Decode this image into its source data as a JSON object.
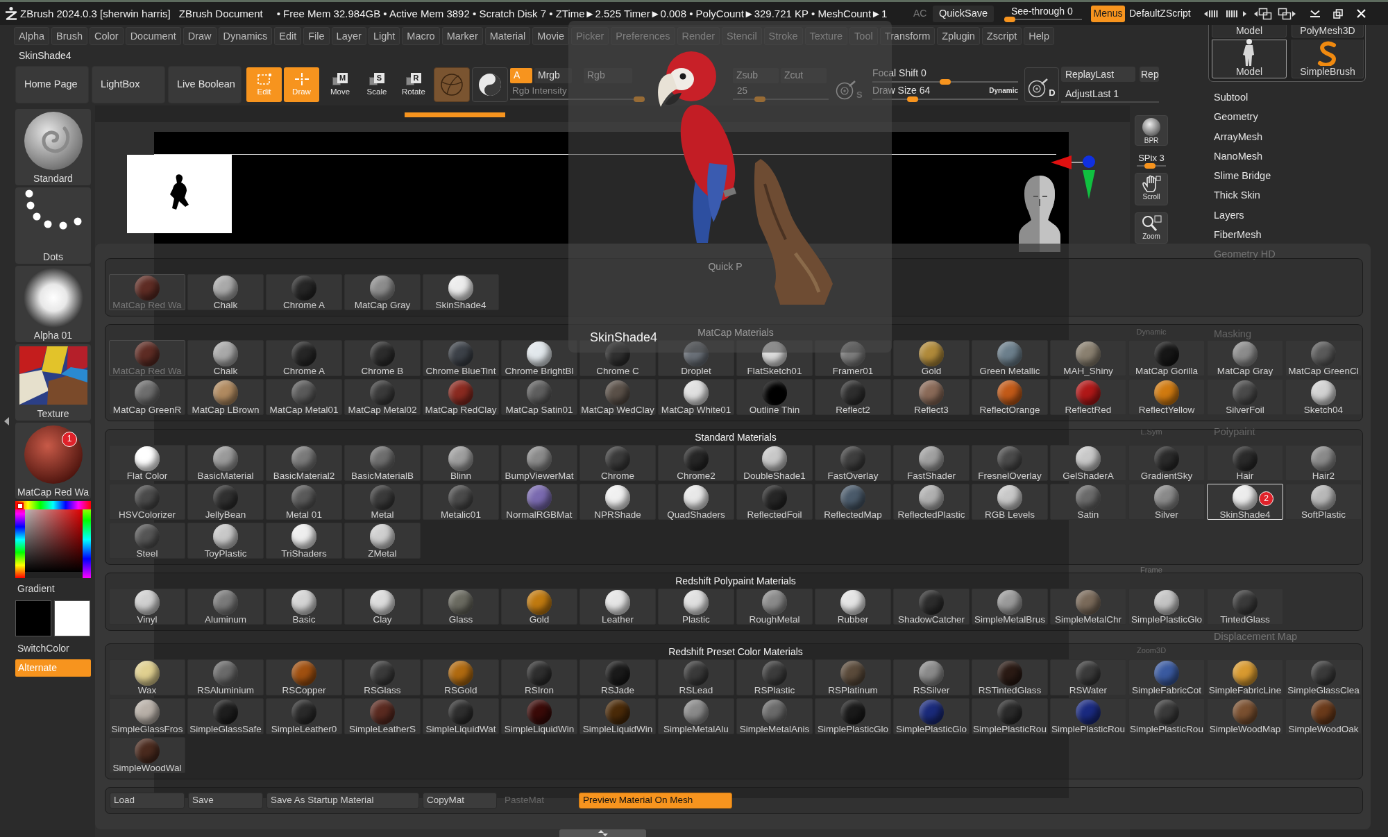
{
  "window": {
    "title": "ZBrush 2024.0.3 [sherwin harris]",
    "document": "ZBrush Document",
    "stats": "• Free Mem 32.984GB • Active Mem 3892 • Scratch Disk 7 • ZTime►2.525 Timer►0.008 • PolyCount►329.721 KP • MeshCount►1",
    "ac": "AC",
    "quicksave": "QuickSave",
    "see_through": {
      "label": "See-through 0",
      "level": 0
    },
    "menus": {
      "label": "Menus",
      "on": true
    },
    "script": "DefaultZScript"
  },
  "menu_bar": [
    "Alpha",
    "Brush",
    "Color",
    "Document",
    "Draw",
    "Dynamics",
    "Edit",
    "File",
    "Layer",
    "Light",
    "Macro",
    "Marker",
    "Material",
    "Movie",
    "Picker",
    "Preferences",
    "Render",
    "Stencil",
    "Stroke",
    "Texture",
    "Tool",
    "Transform",
    "Zplugin",
    "Zscript",
    "Help"
  ],
  "palette_title": "SkinShade4",
  "toolbar": {
    "pages": [
      "Home Page",
      "LightBox",
      "Live Boolean"
    ],
    "modes": [
      {
        "label": "Edit",
        "kind": "edit",
        "on": true
      },
      {
        "label": "Draw",
        "kind": "draw",
        "on": true
      },
      {
        "label": "Move",
        "kind": "letter",
        "glyph": "M",
        "on": false
      },
      {
        "label": "Scale",
        "kind": "letter",
        "glyph": "S",
        "on": false
      },
      {
        "label": "Rotate",
        "kind": "letter",
        "glyph": "R",
        "on": false
      }
    ],
    "channels": [
      {
        "label": "A",
        "on": true
      },
      {
        "label": "Mrgb",
        "on": false
      },
      {
        "label": "Rgb",
        "on": false
      }
    ],
    "rgb_intensity": {
      "label": "Rgb Intensity",
      "level": 1
    },
    "z_modes": [
      {
        "label": "Zsub",
        "on": false
      },
      {
        "label": "Zcut",
        "on": false
      }
    ],
    "z_intensity": {
      "reading": "25",
      "level": 0.25
    },
    "light_button": {
      "glyph": "S"
    },
    "focal_shift": {
      "label": "Focal Shift 0",
      "level": 0.5
    },
    "draw_size": {
      "label": "Draw Size 64",
      "level": 0.26
    },
    "dynamic": "Dynamic",
    "dynamic_button": {
      "glyph": "D"
    },
    "replay": [
      "ReplayLast",
      "Rep"
    ],
    "adjust_last": "AdjustLast 1"
  },
  "left_shelf": {
    "brush": "Standard",
    "stroke": "Dots",
    "alpha": "Alpha 01",
    "texture": "Texture",
    "material": {
      "label": "MatCap Red Wa",
      "badge": "1"
    },
    "gradient": "Gradient",
    "swatches": [
      {
        "color": "#000000"
      },
      {
        "color": "#ffffff"
      }
    ],
    "switch_color": "SwitchColor",
    "alternate": {
      "label": "Alternate",
      "on": true
    }
  },
  "shelf": [
    {
      "label": "BPR",
      "kind": "bpr"
    },
    {
      "label": "SPix 3",
      "kind": "slider",
      "level": 0.43
    },
    {
      "label": "Scroll",
      "kind": "scroll"
    },
    {
      "label": "Zoom",
      "kind": "zoom"
    },
    {
      "label": "Dynamic",
      "kind": "text"
    },
    {
      "label": "L.Sym",
      "kind": "text"
    },
    {
      "label": "Frame",
      "kind": "text"
    },
    {
      "label": "Zoom3D",
      "kind": "text"
    }
  ],
  "right_panel": {
    "thumbnails": [
      {
        "label": "Model",
        "kind": "cut",
        "selected": false
      },
      {
        "label": "PolyMesh3D",
        "kind": "cut",
        "selected": false
      },
      {
        "label": "Model",
        "kind": "figure",
        "selected": true
      },
      {
        "label": "SimpleBrush",
        "kind": "snake",
        "selected": false
      }
    ],
    "items": [
      "Subtool",
      "Geometry",
      "ArrayMesh",
      "NanoMesh",
      "Slime Bridge",
      "Thick Skin",
      "Layers",
      "FiberMesh",
      "Geometry HD",
      "Masking",
      "Polypaint",
      "Displacement Map"
    ]
  },
  "preview": {
    "title": "SkinShade4"
  },
  "material_palette": {
    "sections": [
      {
        "title": "Quick P",
        "tiles": [
          {
            "label": "MatCap Red Wa",
            "color": "#5e2c24",
            "selected": false,
            "disabled": true
          },
          {
            "label": "Chalk",
            "color": "#a9a9a9",
            "selected": false,
            "disabled": false
          },
          {
            "label": "Chrome A",
            "color": "#262626",
            "selected": false,
            "disabled": false
          },
          {
            "label": "MatCap Gray",
            "color": "#8c8c8c",
            "selected": false,
            "disabled": false
          },
          {
            "label": "SkinShade4",
            "color": "#ececec",
            "selected": false,
            "disabled": false
          }
        ]
      },
      {
        "title": "MatCap Materials",
        "tiles": [
          {
            "label": "MatCap Red Wa",
            "color": "#5e2c24",
            "selected": false,
            "disabled": true
          },
          {
            "label": "Chalk",
            "color": "#a9a9a9",
            "selected": false,
            "disabled": false
          },
          {
            "label": "Chrome A",
            "color": "#262626",
            "selected": false,
            "disabled": false
          },
          {
            "label": "Chrome B",
            "color": "#2c2c2c",
            "selected": false,
            "disabled": false
          },
          {
            "label": "Chrome BlueTint",
            "color": "#3c4148",
            "selected": false,
            "disabled": false
          },
          {
            "label": "Chrome BrightBl",
            "color": "#e2e8ec",
            "selected": false,
            "disabled": false
          },
          {
            "label": "Chrome C",
            "color": "#303030",
            "selected": false,
            "disabled": false
          },
          {
            "label": "Droplet",
            "color": "#6a7078",
            "selected": false,
            "disabled": false
          },
          {
            "label": "FlatSketch01",
            "color": "#dcdcdc",
            "selected": false,
            "disabled": false
          },
          {
            "label": "Framer01",
            "color": "#7c7c7c",
            "selected": false,
            "disabled": false
          },
          {
            "label": "Gold",
            "color": "#b08a3a",
            "selected": false,
            "disabled": false
          },
          {
            "label": "Green Metallic",
            "color": "#6c7f8c",
            "selected": false,
            "disabled": false
          },
          {
            "label": "MAH_Shiny",
            "color": "#8a8070",
            "selected": false,
            "disabled": false
          },
          {
            "label": "MatCap Gorilla",
            "color": "#161616",
            "selected": false,
            "disabled": false
          },
          {
            "label": "MatCap Gray",
            "color": "#8c8c8c",
            "selected": false,
            "disabled": false
          },
          {
            "label": "MatCap GreenCl",
            "color": "#5a5a5a",
            "selected": false,
            "disabled": false
          },
          {
            "label": "MatCap GreenR",
            "color": "#6e6e6e",
            "selected": false,
            "disabled": false
          },
          {
            "label": "MatCap LBrown",
            "color": "#b08a60",
            "selected": false,
            "disabled": false
          },
          {
            "label": "MatCap Metal01",
            "color": "#5a5a5a",
            "selected": false,
            "disabled": false
          },
          {
            "label": "MatCap Metal02",
            "color": "#3a3a3a",
            "selected": false,
            "disabled": false
          },
          {
            "label": "MatCap RedClay",
            "color": "#8a2a20",
            "selected": false,
            "disabled": false
          },
          {
            "label": "MatCap Satin01",
            "color": "#5e5e5e",
            "selected": false,
            "disabled": false
          },
          {
            "label": "MatCap WedClay",
            "color": "#5a5048",
            "selected": false,
            "disabled": false
          },
          {
            "label": "MatCap White01",
            "color": "#e0e0e0",
            "selected": false,
            "disabled": false
          },
          {
            "label": "Outline Thin",
            "color": "#000000",
            "selected": false,
            "disabled": false
          },
          {
            "label": "Reflect2",
            "color": "#2e2e2e",
            "selected": false,
            "disabled": false
          },
          {
            "label": "Reflect3",
            "color": "#8a6a58",
            "selected": false,
            "disabled": false
          },
          {
            "label": "ReflectOrange",
            "color": "#c25a18",
            "selected": false,
            "disabled": false
          },
          {
            "label": "ReflectRed",
            "color": "#b01818",
            "selected": false,
            "disabled": false
          },
          {
            "label": "ReflectYellow",
            "color": "#d07a10",
            "selected": false,
            "disabled": false
          },
          {
            "label": "SilverFoil",
            "color": "#4a4a4a",
            "selected": false,
            "disabled": false
          },
          {
            "label": "Sketch04",
            "color": "#d2d2d2",
            "selected": false,
            "disabled": false
          }
        ]
      },
      {
        "title": "Standard Materials",
        "tiles": [
          {
            "label": "Flat Color",
            "color": "#ffffff",
            "selected": false,
            "disabled": false
          },
          {
            "label": "BasicMaterial",
            "color": "#9a9a9a",
            "selected": false,
            "disabled": false
          },
          {
            "label": "BasicMaterial2",
            "color": "#7a7a7a",
            "selected": false,
            "disabled": false
          },
          {
            "label": "BasicMaterialB",
            "color": "#6e6e6e",
            "selected": false,
            "disabled": false
          },
          {
            "label": "Blinn",
            "color": "#9e9e9e",
            "selected": false,
            "disabled": false
          },
          {
            "label": "BumpViewerMat",
            "color": "#8a8a8a",
            "selected": false,
            "disabled": false
          },
          {
            "label": "Chrome",
            "color": "#3a3a3a",
            "selected": false,
            "disabled": false
          },
          {
            "label": "Chrome2",
            "color": "#262626",
            "selected": false,
            "disabled": false
          },
          {
            "label": "DoubleShade1",
            "color": "#c8c8c8",
            "selected": false,
            "disabled": false
          },
          {
            "label": "FastOverlay",
            "color": "#3e3e3e",
            "selected": false,
            "disabled": false
          },
          {
            "label": "FastShader",
            "color": "#a0a0a0",
            "selected": false,
            "disabled": false
          },
          {
            "label": "FresnelOverlay",
            "color": "#4a4a4a",
            "selected": false,
            "disabled": false
          },
          {
            "label": "GelShaderA",
            "color": "#c8c8c8",
            "selected": false,
            "disabled": false
          },
          {
            "label": "GradientSky",
            "color": "#2a2a2a",
            "selected": false,
            "disabled": false
          },
          {
            "label": "Hair",
            "color": "#2a2a2a",
            "selected": false,
            "disabled": false
          },
          {
            "label": "Hair2",
            "color": "#8a8a8a",
            "selected": false,
            "disabled": false
          },
          {
            "label": "HSVColorizer",
            "color": "#4a4a4a",
            "selected": false,
            "disabled": false
          },
          {
            "label": "JellyBean",
            "color": "#303030",
            "selected": false,
            "disabled": false
          },
          {
            "label": "Metal 01",
            "color": "#5a5a5a",
            "selected": false,
            "disabled": false
          },
          {
            "label": "Metal",
            "color": "#3a3a3a",
            "selected": false,
            "disabled": false
          },
          {
            "label": "Metalic01",
            "color": "#4a4a4a",
            "selected": false,
            "disabled": false
          },
          {
            "label": "NormalRGBMat",
            "color": "#7a6ab0",
            "selected": false,
            "disabled": false
          },
          {
            "label": "NPRShade",
            "color": "#f0f0f0",
            "selected": false,
            "disabled": false
          },
          {
            "label": "QuadShaders",
            "color": "#e8e8e8",
            "selected": false,
            "disabled": false
          },
          {
            "label": "ReflectedFoil",
            "color": "#262626",
            "selected": false,
            "disabled": false
          },
          {
            "label": "ReflectedMap",
            "color": "#4a5a6a",
            "selected": false,
            "disabled": false
          },
          {
            "label": "ReflectedPlastic",
            "color": "#b0b0b0",
            "selected": false,
            "disabled": false
          },
          {
            "label": "RGB Levels",
            "color": "#c8c8c8",
            "selected": false,
            "disabled": false
          },
          {
            "label": "Satin",
            "color": "#6a6a6a",
            "selected": false,
            "disabled": false
          },
          {
            "label": "Silver",
            "color": "#8a8a8a",
            "selected": false,
            "disabled": false
          },
          {
            "label": "SkinShade4",
            "color": "#ececec",
            "selected": true,
            "disabled": false,
            "badge": "2"
          },
          {
            "label": "SoftPlastic",
            "color": "#b8b8b8",
            "selected": false,
            "disabled": false
          },
          {
            "label": "Steel",
            "color": "#555555",
            "selected": false,
            "disabled": false
          },
          {
            "label": "ToyPlastic",
            "color": "#c8c8c8",
            "selected": false,
            "disabled": false
          },
          {
            "label": "TriShaders",
            "color": "#eeeeee",
            "selected": false,
            "disabled": false
          },
          {
            "label": "ZMetal",
            "color": "#cfcfcf",
            "selected": false,
            "disabled": false
          }
        ]
      },
      {
        "title": "Redshift Polypaint Materials",
        "tiles": [
          {
            "label": "Vinyl",
            "color": "#d0d0d0",
            "selected": false,
            "disabled": false
          },
          {
            "label": "Aluminum",
            "color": "#7a7a7a",
            "selected": false,
            "disabled": false
          },
          {
            "label": "Basic",
            "color": "#d4d4d4",
            "selected": false,
            "disabled": false
          },
          {
            "label": "Clay",
            "color": "#dcdcdc",
            "selected": false,
            "disabled": false
          },
          {
            "label": "Glass",
            "color": "#6a6a60",
            "selected": false,
            "disabled": false
          },
          {
            "label": "Gold",
            "color": "#c07a10",
            "selected": false,
            "disabled": false
          },
          {
            "label": "Leather",
            "color": "#e6e6e6",
            "selected": false,
            "disabled": false
          },
          {
            "label": "Plastic",
            "color": "#e0e0e0",
            "selected": false,
            "disabled": false
          },
          {
            "label": "RoughMetal",
            "color": "#8a8a8a",
            "selected": false,
            "disabled": false
          },
          {
            "label": "Rubber",
            "color": "#e4e4e4",
            "selected": false,
            "disabled": false
          },
          {
            "label": "ShadowCatcher",
            "color": "#2c2c2c",
            "selected": false,
            "disabled": false
          },
          {
            "label": "SimpleMetalBrus",
            "color": "#9a9a9a",
            "selected": false,
            "disabled": false
          },
          {
            "label": "SimpleMetalChr",
            "color": "#7a6a5a",
            "selected": false,
            "disabled": false
          },
          {
            "label": "SimplePlasticGlo",
            "color": "#c4c4c4",
            "selected": false,
            "disabled": false
          },
          {
            "label": "TintedGlass",
            "color": "#3a3a3a",
            "selected": false,
            "disabled": false
          }
        ]
      },
      {
        "title": "Redshift Preset Color Materials",
        "tiles": [
          {
            "label": "Wax",
            "color": "#e0d090",
            "selected": false,
            "disabled": false
          },
          {
            "label": "RSAluminium",
            "color": "#6a6a6a",
            "selected": false,
            "disabled": false
          },
          {
            "label": "RSCopper",
            "color": "#a05010",
            "selected": false,
            "disabled": false
          },
          {
            "label": "RSGlass",
            "color": "#3a3a3a",
            "selected": false,
            "disabled": false
          },
          {
            "label": "RSGold",
            "color": "#b06a10",
            "selected": false,
            "disabled": false
          },
          {
            "label": "RSIron",
            "color": "#2e2e2e",
            "selected": false,
            "disabled": false
          },
          {
            "label": "RSJade",
            "color": "#1a1a1a",
            "selected": false,
            "disabled": false
          },
          {
            "label": "RSLead",
            "color": "#3a3a3a",
            "selected": false,
            "disabled": false
          },
          {
            "label": "RSPlastic",
            "color": "#3c3c3c",
            "selected": false,
            "disabled": false
          },
          {
            "label": "RSPlatinum",
            "color": "#5a4a3a",
            "selected": false,
            "disabled": false
          },
          {
            "label": "RSSilver",
            "color": "#8a8a8a",
            "selected": false,
            "disabled": false
          },
          {
            "label": "RSTintedGlass",
            "color": "#2a1a14",
            "selected": false,
            "disabled": false
          },
          {
            "label": "RSWater",
            "color": "#3a3a3a",
            "selected": false,
            "disabled": false
          },
          {
            "label": "SimpleFabricCot",
            "color": "#3a5aa0",
            "selected": false,
            "disabled": false
          },
          {
            "label": "SimpleFabricLine",
            "color": "#d89a30",
            "selected": false,
            "disabled": false
          },
          {
            "label": "SimpleGlassClea",
            "color": "#3a3a3a",
            "selected": false,
            "disabled": false
          },
          {
            "label": "SimpleGlassFros",
            "color": "#b8b0a8",
            "selected": false,
            "disabled": false
          },
          {
            "label": "SimpleGlassSafe",
            "color": "#1e1e1e",
            "selected": false,
            "disabled": false
          },
          {
            "label": "SimpleLeather0",
            "color": "#2a2a2a",
            "selected": false,
            "disabled": false
          },
          {
            "label": "SimpleLeatherS",
            "color": "#5a2a20",
            "selected": false,
            "disabled": false
          },
          {
            "label": "SimpleLiquidWat",
            "color": "#2e2e2e",
            "selected": false,
            "disabled": false
          },
          {
            "label": "SimpleLiquidWin",
            "color": "#3a0a08",
            "selected": false,
            "disabled": false
          },
          {
            "label": "SimpleLiquidWin",
            "color": "#4a2a08",
            "selected": false,
            "disabled": false
          },
          {
            "label": "SimpleMetalAlu",
            "color": "#8a8a8a",
            "selected": false,
            "disabled": false
          },
          {
            "label": "SimpleMetalAnis",
            "color": "#6a6a6a",
            "selected": false,
            "disabled": false
          },
          {
            "label": "SimplePlasticGlo",
            "color": "#1a1a1a",
            "selected": false,
            "disabled": false
          },
          {
            "label": "SimplePlasticGlo",
            "color": "#1a2a7a",
            "selected": false,
            "disabled": false
          },
          {
            "label": "SimplePlasticRou",
            "color": "#2a2a2a",
            "selected": false,
            "disabled": false
          },
          {
            "label": "SimplePlasticRou",
            "color": "#1a2a80",
            "selected": false,
            "disabled": false
          },
          {
            "label": "SimplePlasticRou",
            "color": "#3a3a3a",
            "selected": false,
            "disabled": false
          },
          {
            "label": "SimpleWoodMap",
            "color": "#7a5030",
            "selected": false,
            "disabled": false
          },
          {
            "label": "SimpleWoodOak",
            "color": "#6a3a1a",
            "selected": false,
            "disabled": false
          },
          {
            "label": "SimpleWoodWal",
            "color": "#4a2a1e",
            "selected": false,
            "disabled": false
          }
        ]
      }
    ],
    "actions": [
      {
        "label": "Load",
        "disabled": false,
        "on": false
      },
      {
        "label": "Save",
        "disabled": false,
        "on": false
      },
      {
        "label": "Save As Startup Material",
        "disabled": false,
        "on": false
      },
      {
        "label": "CopyMat",
        "disabled": false,
        "on": false
      },
      {
        "label": "PasteMat",
        "disabled": true,
        "on": false
      },
      {
        "label": "Preview Material On Mesh",
        "disabled": false,
        "on": true
      }
    ]
  }
}
